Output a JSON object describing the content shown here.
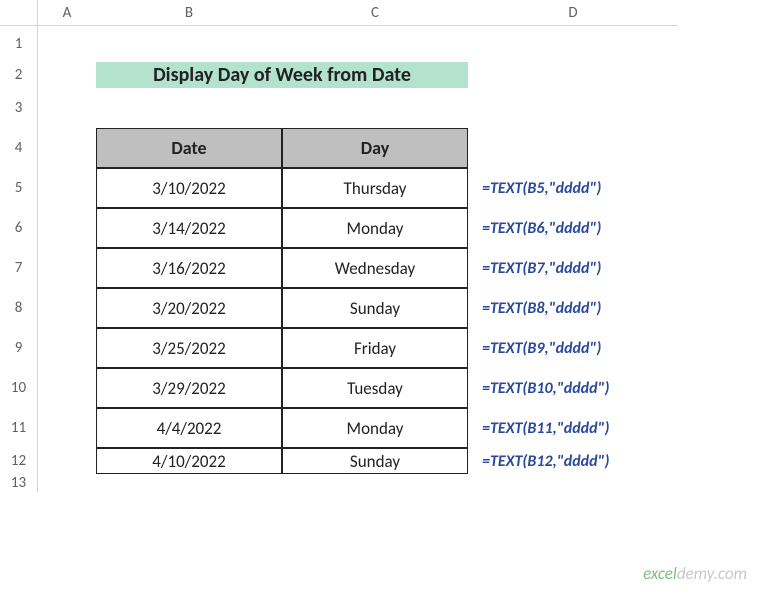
{
  "columns": [
    "A",
    "B",
    "C",
    "D"
  ],
  "rows": [
    "1",
    "2",
    "3",
    "4",
    "5",
    "6",
    "7",
    "8",
    "9",
    "10",
    "11",
    "12",
    "13"
  ],
  "title": "Display Day of Week from Date",
  "headers": {
    "date": "Date",
    "day": "Day"
  },
  "data": [
    {
      "date": "3/10/2022",
      "day": "Thursday",
      "formula": "=TEXT(B5,\"dddd\")"
    },
    {
      "date": "3/14/2022",
      "day": "Monday",
      "formula": "=TEXT(B6,\"dddd\")"
    },
    {
      "date": "3/16/2022",
      "day": "Wednesday",
      "formula": "=TEXT(B7,\"dddd\")"
    },
    {
      "date": "3/20/2022",
      "day": "Sunday",
      "formula": "=TEXT(B8,\"dddd\")"
    },
    {
      "date": "3/25/2022",
      "day": "Friday",
      "formula": "=TEXT(B9,\"dddd\")"
    },
    {
      "date": "3/29/2022",
      "day": "Tuesday",
      "formula": "=TEXT(B10,\"dddd\")"
    },
    {
      "date": "4/4/2022",
      "day": "Monday",
      "formula": "=TEXT(B11,\"dddd\")"
    },
    {
      "date": "4/10/2022",
      "day": "Sunday",
      "formula": "=TEXT(B12,\"dddd\")"
    }
  ],
  "watermark": {
    "part1": "excel",
    "part2": "demy",
    "suffix": ".com"
  }
}
